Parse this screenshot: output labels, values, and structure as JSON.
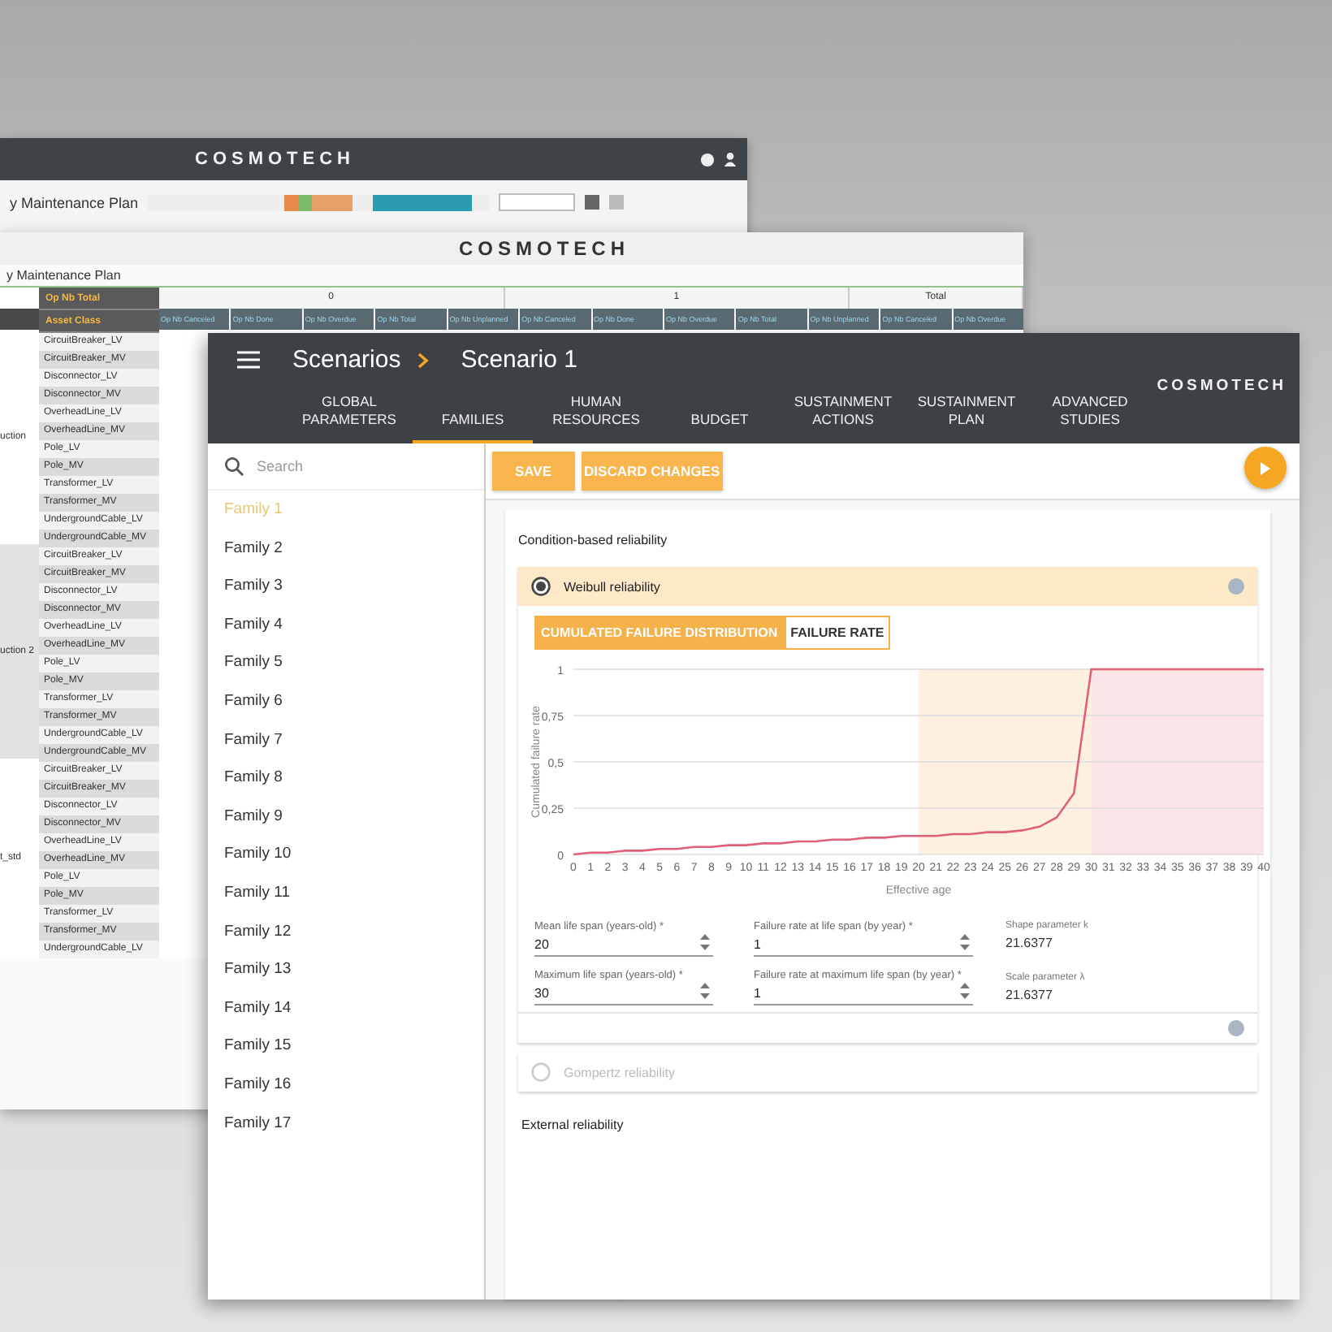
{
  "background_windows": [
    {
      "logo": "COSMOTECH",
      "title": "y Maintenance Plan"
    },
    {
      "logo": "COSMOTECH",
      "title": "y Maintenance Plan",
      "table": {
        "total_header": "Op Nb Total",
        "asset_class_header": "Asset Class",
        "group_headers": [
          "0",
          "1",
          "Total"
        ],
        "subheaders": [
          "Op Nb Canceled",
          "Op Nb Done",
          "Op Nb Overdue",
          "Op Nb Total",
          "Op Nb Unplanned",
          "Op Nb Canceled",
          "Op Nb Done",
          "Op Nb Overdue",
          "Op Nb Total",
          "Op Nb Unplanned",
          "Op Nb Canceled",
          "Op Nb Overdue"
        ],
        "row_groups": [
          {
            "label": "uction",
            "rows": [
              "CircuitBreaker_LV",
              "CircuitBreaker_MV",
              "Disconnector_LV",
              "Disconnector_MV",
              "OverheadLine_LV",
              "OverheadLine_MV",
              "Pole_LV",
              "Pole_MV",
              "Transformer_LV",
              "Transformer_MV",
              "UndergroundCable_LV",
              "UndergroundCable_MV"
            ]
          },
          {
            "label": "uction 2",
            "rows": [
              "CircuitBreaker_LV",
              "CircuitBreaker_MV",
              "Disconnector_LV",
              "Disconnector_MV",
              "OverheadLine_LV",
              "OverheadLine_MV",
              "Pole_LV",
              "Pole_MV",
              "Transformer_LV",
              "Transformer_MV",
              "UndergroundCable_LV",
              "UndergroundCable_MV"
            ]
          },
          {
            "label": "t_std",
            "rows": [
              "CircuitBreaker_LV",
              "CircuitBreaker_MV",
              "Disconnector_LV",
              "Disconnector_MV",
              "OverheadLine_LV",
              "OverheadLine_MV",
              "Pole_LV",
              "Pole_MV",
              "Transformer_LV",
              "Transformer_MV",
              "UndergroundCable_LV"
            ]
          }
        ]
      }
    }
  ],
  "app": {
    "breadcrumb": [
      "Scenarios",
      "Scenario 1"
    ],
    "logo": "COSMOTECH",
    "tabs": [
      {
        "label": "GLOBAL PARAMETERS",
        "selected": false
      },
      {
        "label": "FAMILIES",
        "selected": true
      },
      {
        "label": "HUMAN RESOURCES",
        "selected": false
      },
      {
        "label": "BUDGET",
        "selected": false
      },
      {
        "label": "SUSTAINMENT ACTIONS",
        "selected": false
      },
      {
        "label": "SUSTAINMENT PLAN",
        "selected": false
      },
      {
        "label": "ADVANCED STUDIES",
        "selected": false
      }
    ],
    "sidebar": {
      "search": {
        "placeholder": "Search"
      },
      "items": [
        {
          "label": "Family 1",
          "selected": true
        },
        {
          "label": "Family 2",
          "selected": false
        },
        {
          "label": "Family 3",
          "selected": false
        },
        {
          "label": "Family 4",
          "selected": false
        },
        {
          "label": "Family 5",
          "selected": false
        },
        {
          "label": "Family 6",
          "selected": false
        },
        {
          "label": "Family 7",
          "selected": false
        },
        {
          "label": "Family 8",
          "selected": false
        },
        {
          "label": "Family 9",
          "selected": false
        },
        {
          "label": "Family 10",
          "selected": false
        },
        {
          "label": "Family 11",
          "selected": false
        },
        {
          "label": "Family 12",
          "selected": false
        },
        {
          "label": "Family 13",
          "selected": false
        },
        {
          "label": "Family 14",
          "selected": false
        },
        {
          "label": "Family 15",
          "selected": false
        },
        {
          "label": "Family 16",
          "selected": false
        },
        {
          "label": "Family 17",
          "selected": false
        }
      ]
    },
    "actions": [
      "SAVE",
      "DISCARD CHANGES"
    ],
    "section_title": "Condition-based reliability",
    "models": [
      {
        "label": "Weibull reliability",
        "selected": true
      },
      {
        "label": "Gompertz reliability",
        "selected": false
      }
    ],
    "chart_tabs": [
      {
        "label": "CUMULATED FAILURE DISTRIBUTION",
        "selected": true
      },
      {
        "label": "FAILURE RATE",
        "selected": false
      }
    ],
    "chart_data": {
      "type": "line",
      "xlabel": "Effective age",
      "ylabel": "Cumulated failure rate",
      "x": [
        0,
        1,
        2,
        3,
        4,
        5,
        6,
        7,
        8,
        9,
        10,
        11,
        12,
        13,
        14,
        15,
        16,
        17,
        18,
        19,
        20,
        21,
        22,
        23,
        24,
        25,
        26,
        27,
        28,
        29,
        30,
        31,
        32,
        33,
        34,
        35,
        36,
        37,
        38,
        39,
        40
      ],
      "series": [
        {
          "color": "#e0607a",
          "values": [
            0,
            0.01,
            0.01,
            0.02,
            0.02,
            0.03,
            0.03,
            0.04,
            0.04,
            0.05,
            0.05,
            0.06,
            0.06,
            0.07,
            0.07,
            0.08,
            0.08,
            0.09,
            0.09,
            0.1,
            0.1,
            0.1,
            0.11,
            0.11,
            0.12,
            0.12,
            0.13,
            0.15,
            0.2,
            0.33,
            1,
            1,
            1,
            1,
            1,
            1,
            1,
            1,
            1,
            1,
            1
          ]
        }
      ],
      "grid": true,
      "xlim": [
        0,
        40
      ],
      "ylim": [
        0,
        1
      ],
      "xticks": [
        0,
        1,
        2,
        3,
        4,
        5,
        6,
        7,
        8,
        9,
        10,
        11,
        12,
        13,
        14,
        15,
        16,
        17,
        18,
        19,
        20,
        21,
        22,
        23,
        24,
        25,
        26,
        27,
        28,
        29,
        30,
        31,
        32,
        33,
        34,
        35,
        36,
        37,
        38,
        39,
        40
      ],
      "yticks": [
        {
          "value": 0,
          "label": "0"
        },
        {
          "value": 0.25,
          "label": "0,25"
        },
        {
          "value": 0.5,
          "label": "0,5"
        },
        {
          "value": 0.75,
          "label": "0,75"
        },
        {
          "value": 1,
          "label": "1"
        }
      ],
      "bands": [
        {
          "axis": "x",
          "from": 20,
          "to": 30,
          "color": "#fdf0e1"
        },
        {
          "axis": "x",
          "from": 30,
          "to": 40,
          "color": "#fbe4e6"
        }
      ]
    },
    "fields": [
      {
        "label": "Mean life span (years-old) *",
        "value": "20"
      },
      {
        "label": "Failure rate at life span (by year) *",
        "value": "1"
      },
      {
        "label": "Maximum life span (years-old) *",
        "value": "30"
      },
      {
        "label": "Failure rate at maximum life span (by year) *",
        "value": "1"
      }
    ],
    "readouts": [
      {
        "label": "Shape parameter k",
        "value": "21.6377"
      },
      {
        "label": "Scale parameter λ",
        "value": "21.6377"
      }
    ],
    "external_title": "External reliability"
  }
}
